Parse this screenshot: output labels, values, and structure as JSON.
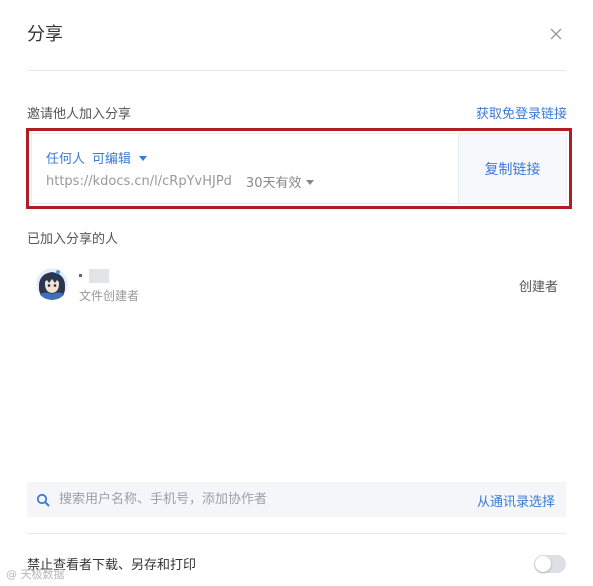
{
  "dialog": {
    "title": "分享",
    "close_icon": "close-icon"
  },
  "invite": {
    "label": "邀请他人加入分享",
    "login_free_link": "获取免登录链接"
  },
  "share_link": {
    "permission_who": "任何人",
    "permission_level": "可编辑",
    "url": "https://kdocs.cn/l/cRpYvHJPd",
    "validity": "30天有效",
    "copy_button": "复制链接"
  },
  "members": {
    "label": "已加入分享的人",
    "items": [
      {
        "subtitle": "文件创建者",
        "role": "创建者",
        "avatar_icon": "anime-avatar"
      }
    ]
  },
  "search": {
    "placeholder": "搜索用户名称、手机号，添加协作者",
    "icon": "search-icon",
    "contacts_link": "从通讯录选择"
  },
  "settings": {
    "disable_download_label": "禁止查看者下载、另存和打印",
    "disable_download_enabled": false
  },
  "watermark": "@ 天极数据",
  "colors": {
    "accent": "#3a7bd5",
    "highlight_border": "#b01e23",
    "toggle_off": "#dcdfe4"
  }
}
